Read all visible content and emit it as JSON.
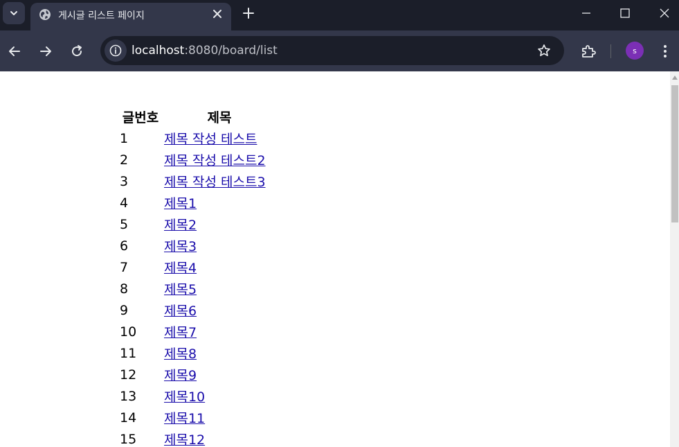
{
  "browser": {
    "tab_title": "게시글 리스트 페이지",
    "url_host": "localhost",
    "url_path": ":8080/board/list",
    "avatar_letter": "s",
    "colors": {
      "tabstrip": "#1b1e29",
      "toolbar": "#33374a",
      "avatar": "#7b2fb5"
    }
  },
  "icons": [
    "tab-search-icon",
    "globe-icon",
    "close-icon",
    "plus-icon",
    "minimize-icon",
    "maximize-icon",
    "close-window-icon",
    "back-icon",
    "forward-icon",
    "reload-icon",
    "info-icon",
    "star-icon",
    "extensions-icon",
    "kebab-menu-icon"
  ],
  "board": {
    "headers": {
      "no": "글번호",
      "title": "제목"
    },
    "rows": [
      {
        "no": "1",
        "title": "제목 작성 테스트"
      },
      {
        "no": "2",
        "title": "제목 작성 테스트2"
      },
      {
        "no": "3",
        "title": "제목 작성 테스트3"
      },
      {
        "no": "4",
        "title": "제목1"
      },
      {
        "no": "5",
        "title": "제목2"
      },
      {
        "no": "6",
        "title": "제목3"
      },
      {
        "no": "7",
        "title": "제목4"
      },
      {
        "no": "8",
        "title": "제목5"
      },
      {
        "no": "9",
        "title": "제목6"
      },
      {
        "no": "10",
        "title": "제목7"
      },
      {
        "no": "11",
        "title": "제목8"
      },
      {
        "no": "12",
        "title": "제목9"
      },
      {
        "no": "13",
        "title": "제목10"
      },
      {
        "no": "14",
        "title": "제목11"
      },
      {
        "no": "15",
        "title": "제목12"
      }
    ]
  }
}
